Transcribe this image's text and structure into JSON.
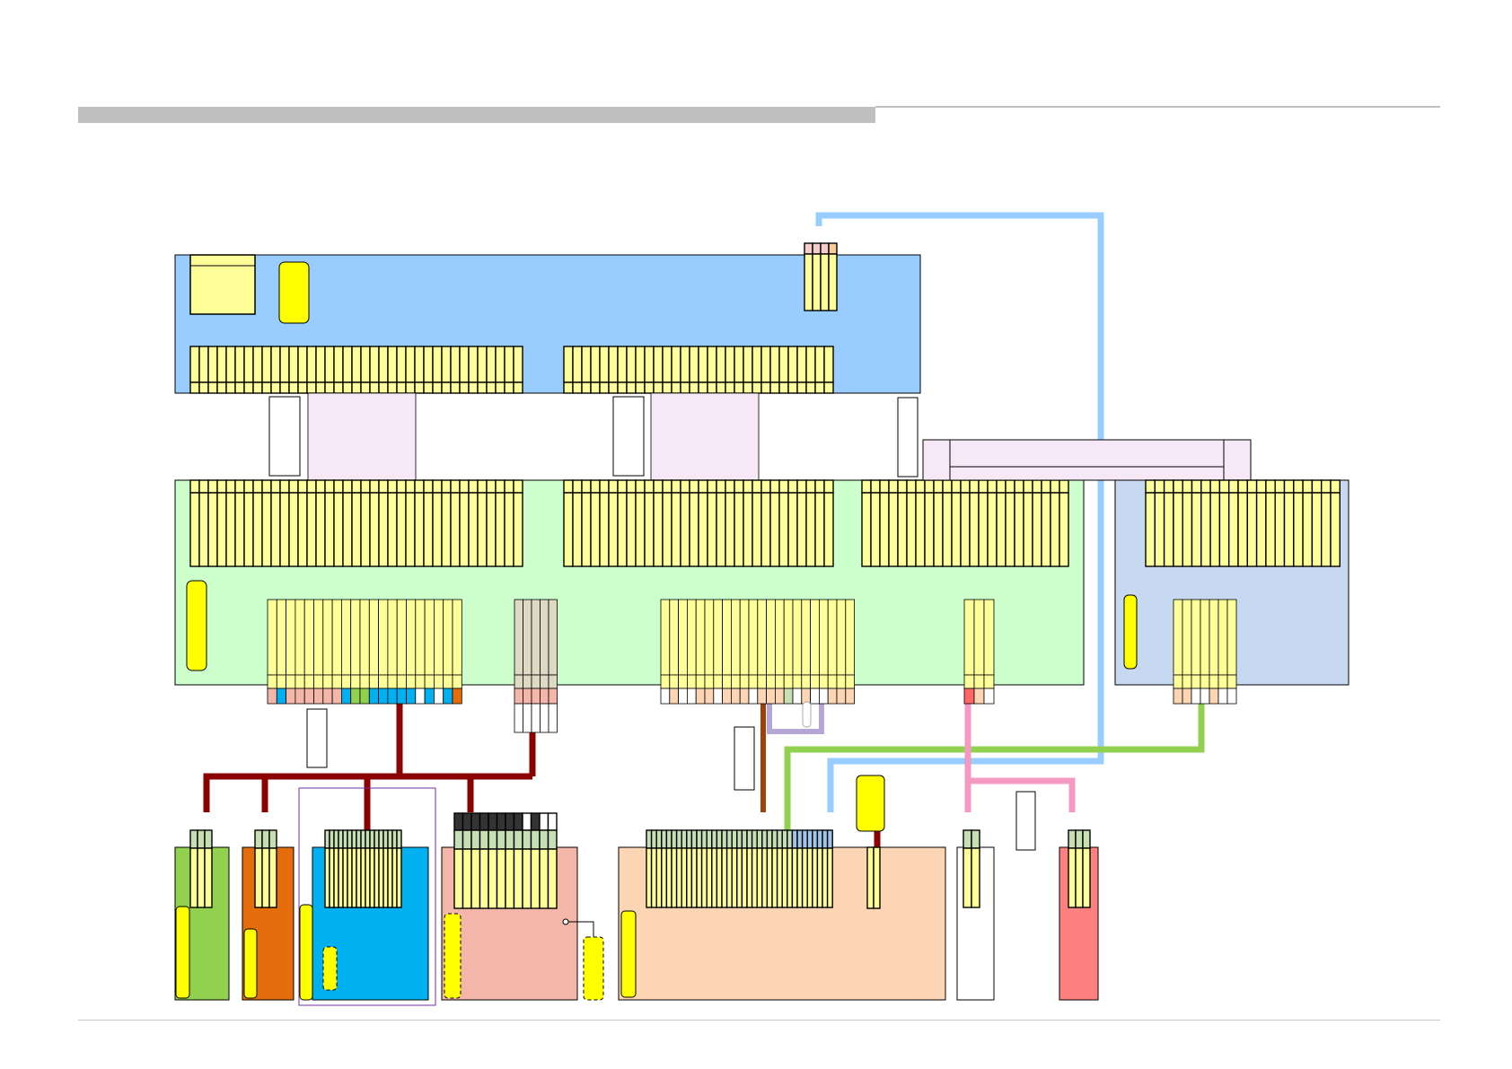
{
  "header": {
    "bar_color": "#c0c0c0"
  },
  "colors": {
    "main_board": "#99ccff",
    "mid_board": "#ccffcc",
    "side_board": "#c6d9f1",
    "pin": "#ffff99",
    "flex": "#f6e8f6",
    "chip": "#ffff00",
    "bus_main": "#8b0000",
    "cable_blue": "#99ccff",
    "cable_green": "#92d050",
    "cable_pink": "#f49ac2",
    "cable_purple": "#b4a7d6",
    "cable_brown": "#a0410a",
    "board_green": "#92d050",
    "board_orange": "#e46c0a",
    "board_cyan": "#00b0f0",
    "board_salmon": "#f4b6a8",
    "board_peach": "#fcd5b4",
    "board_white": "#ffffff",
    "board_red": "#ff8080"
  },
  "icons": [
    "connector-icon",
    "chip-icon",
    "test-point-icon"
  ]
}
